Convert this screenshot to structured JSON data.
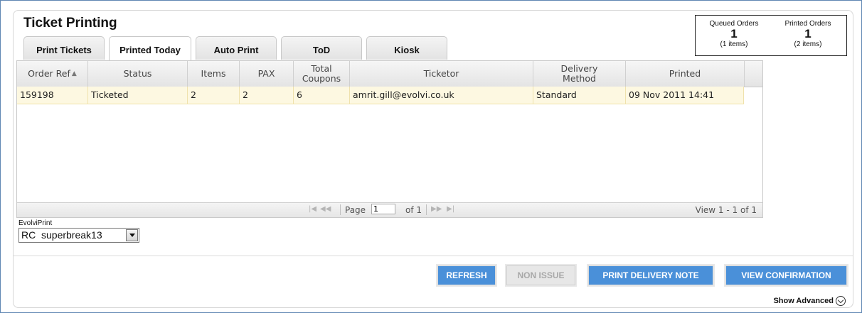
{
  "page": {
    "title": "Ticket Printing"
  },
  "tabs": [
    {
      "label": "Print Tickets"
    },
    {
      "label": "Printed Today"
    },
    {
      "label": "Auto Print"
    },
    {
      "label": "ToD"
    },
    {
      "label": "Kiosk"
    }
  ],
  "active_tab": "Printed Today",
  "summary": {
    "queued": {
      "label": "Queued Orders",
      "count": "1",
      "items": "(1 items)"
    },
    "printed": {
      "label": "Printed Orders",
      "count": "1",
      "items": "(2 items)"
    }
  },
  "grid": {
    "columns": [
      "Order Ref",
      "Status",
      "Items",
      "PAX",
      "Total Coupons",
      "Ticketor",
      "Delivery Method",
      "Printed"
    ],
    "rows": [
      [
        "159198",
        "Ticketed",
        "2",
        "2",
        "6",
        "amrit.gill@evolvi.co.uk",
        "Standard",
        "09 Nov 2011 14:41"
      ]
    ],
    "pager": {
      "page_label": "Page",
      "page_value": "1",
      "of_label": "of 1",
      "view_text": "View 1 - 1 of 1"
    }
  },
  "evolviprint": {
    "label": "EvolviPrint",
    "selected": "RC  superbreak13"
  },
  "buttons": {
    "refresh": "REFRESH",
    "non_issue": "NON ISSUE",
    "print_delivery_note": "PRINT DELIVERY NOTE",
    "view_confirmation": "VIEW CONFIRMATION"
  },
  "show_advanced": "Show Advanced",
  "colors": {
    "button": "#4a90d9",
    "row_highlight": "#fdf8e1",
    "frame": "#5f86b3"
  }
}
